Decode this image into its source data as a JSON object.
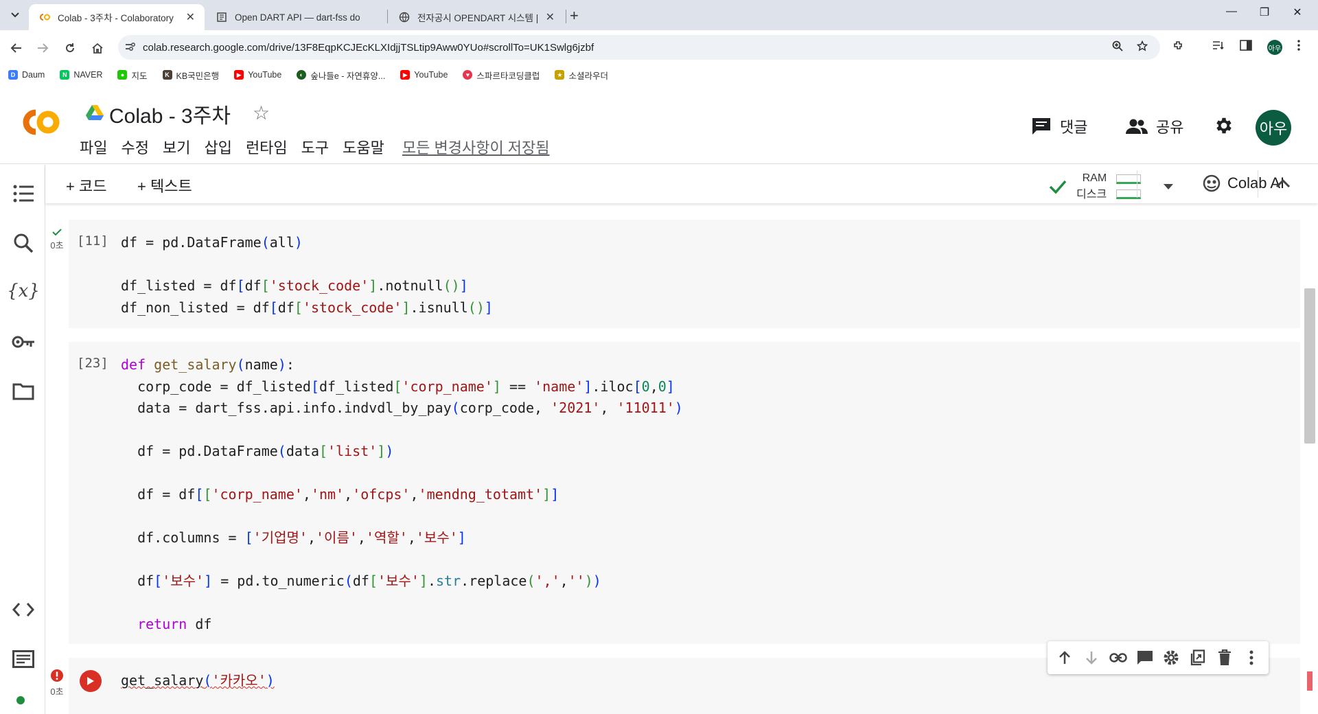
{
  "browser": {
    "tabs": [
      {
        "title": "Colab - 3주차 - Colaboratory",
        "active": true
      },
      {
        "title": "Open DART API — dart-fss do",
        "active": false
      },
      {
        "title": "전자공시 OPENDART 시스템 |",
        "active": false
      }
    ],
    "url": "colab.research.google.com/drive/13F8EqpKCJEcKLXIdjjTSLtip9Aww0YUo#scrollTo=UK1Swlg6jzbf",
    "profile_initial": "아우",
    "bookmarks": [
      {
        "label": "Daum",
        "color": "#3b7df6"
      },
      {
        "label": "NAVER",
        "color": "#03c75a"
      },
      {
        "label": "지도",
        "color": "#1ec800"
      },
      {
        "label": "KB국민은행",
        "color": "#4a4035"
      },
      {
        "label": "YouTube",
        "color": "#ff0000"
      },
      {
        "label": "숲나들e - 자연휴양...",
        "color": "#1b5e20"
      },
      {
        "label": "YouTube",
        "color": "#ff0000"
      },
      {
        "label": "스파르타코딩클럽",
        "color": "#e8344e"
      },
      {
        "label": "소셜라우더",
        "color": "#c8a000"
      }
    ]
  },
  "colab": {
    "title": "Colab - 3주차",
    "menu": [
      "파일",
      "수정",
      "보기",
      "삽입",
      "런타임",
      "도구",
      "도움말"
    ],
    "saved_status": "모든 변경사항이 저장됨",
    "comment_label": "댓글",
    "share_label": "공유",
    "avatar_initial": "아우",
    "add_code_label": "+ 코드",
    "add_text_label": "+ 텍스트",
    "ram_label": "RAM",
    "disk_label": "디스크",
    "colab_ai_label": "Colab AI",
    "accent_color": "#f9ab00",
    "status_ok_color": "#34a853",
    "error_color": "#d93025"
  },
  "cells": [
    {
      "exec_count": "[11]",
      "status": "done",
      "time": "0초",
      "code": "df = pd.DataFrame(all)\n\ndf_listed = df[df['stock_code'].notnull()]\ndf_non_listed = df[df['stock_code'].isnull()]"
    },
    {
      "exec_count": "[23]",
      "status": "none",
      "time": "",
      "code": "def get_salary(name):\n  corp_code = df_listed[df_listed['corp_name'] == 'name'].iloc[0,0]\n  data = dart_fss.api.info.indvdl_by_pay(corp_code, '2021', '11011')\n\n  df = pd.DataFrame(data['list'])\n\n  df = df[['corp_name','nm','ofcps','mendng_totamt']]\n\n  df.columns = ['기업명','이름','역할','보수']\n\n  df['보수'] = pd.to_numeric(df['보수'].str.replace(',',''))\n\n  return df"
    },
    {
      "exec_count": "",
      "status": "error",
      "time": "0초",
      "code": "get_salary('카카오')"
    }
  ]
}
